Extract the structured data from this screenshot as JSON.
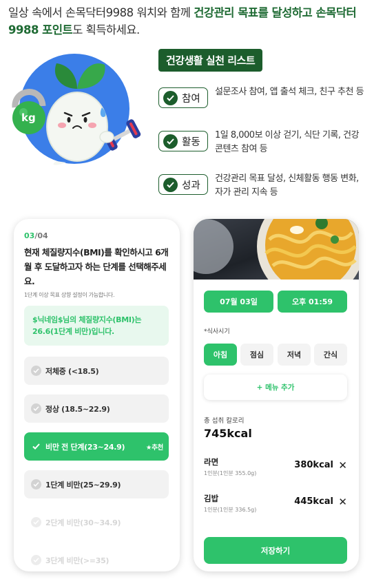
{
  "intro": {
    "part1": "일상 속에서 손목닥터9988 워치와 함께 ",
    "highlight1": "건강관리 목표를 달성하고 손목닥터9988 포인트",
    "part2": "도 획득하세요."
  },
  "practice": {
    "title": "건강생활 실천 리스트",
    "items": [
      {
        "label": "참여",
        "desc": "설문조사 참여, 앱 출석 체크, 친구 추천 등"
      },
      {
        "label": "활동",
        "desc": "1일 8,000보 이상 걷기, 식단 기록, 건강 콘텐츠 참여 등"
      },
      {
        "label": "성과",
        "desc": "건강관리 목표 달성, 신체활동 행동 변화, 자가 관리 지속 등"
      }
    ]
  },
  "hero": {
    "kettlebell_text": "kg"
  },
  "bmi_screen": {
    "step_current": "03",
    "step_total": "/04",
    "question": "현재 체질량지수(BMI)를 확인하시고 6개월 후 도달하고자 하는 단계를 선택해주세요.",
    "sub": "1단계 이상 목표 상향 설정이 가능합니다.",
    "notice": "$닉네임$님의 체질량지수(BMI)는 26.6(1단계 비만)입니다.",
    "options": [
      {
        "label": "저체중 (<18.5)",
        "state": "normal"
      },
      {
        "label": "정상 (18.5~22.9)",
        "state": "normal"
      },
      {
        "label": "비만 전 단계(23~24.9)",
        "state": "selected"
      },
      {
        "label": "1단계 비만(25~29.9)",
        "state": "normal"
      },
      {
        "label": "2단계 비만(30~34.9)",
        "state": "disabled"
      },
      {
        "label": "3단계 비만(>=35)",
        "state": "disabled"
      }
    ],
    "recommend_label": "★추천"
  },
  "meal_screen": {
    "date": "07월 03일",
    "time": "오후 01:59",
    "meal_label": "*식사시기",
    "meal_tabs": [
      "아침",
      "점심",
      "저녁",
      "간식"
    ],
    "active_tab": 0,
    "add_menu": "+ 메뉴 추가",
    "total_label": "총 섭취 칼로리",
    "total_kcal": "745kcal",
    "foods": [
      {
        "name": "라면",
        "portion": "1인분(1인분 355.0g)",
        "kcal": "380kcal"
      },
      {
        "name": "김밥",
        "portion": "1인분(1인분 336.5g)",
        "kcal": "445kcal"
      }
    ],
    "close_glyph": "✕",
    "save": "저장하기"
  },
  "colors": {
    "dark_green": "#1c5d2c",
    "accent_green": "#2ec26b",
    "light_green_bg": "#e8f8ee",
    "hero_blue": "#3b7ee8"
  }
}
